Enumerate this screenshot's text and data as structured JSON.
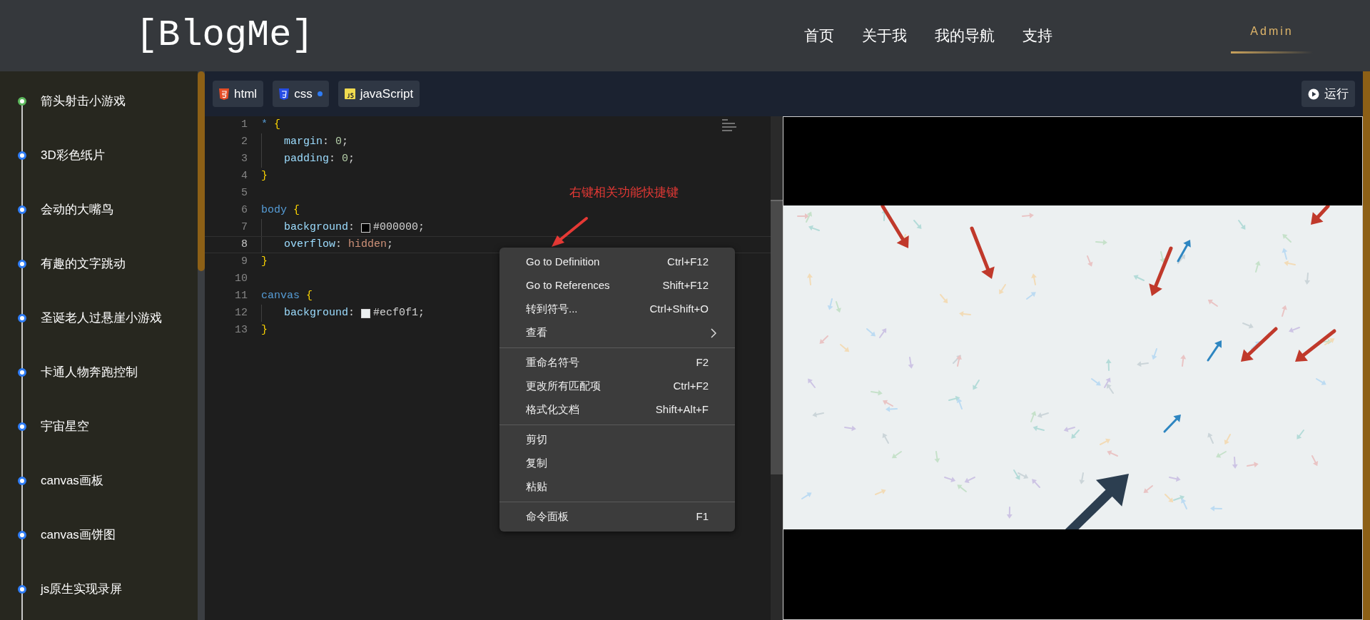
{
  "header": {
    "logo": "[BlogMe]",
    "nav": [
      "首页",
      "关于我",
      "我的导航",
      "支持"
    ],
    "user": "Admin"
  },
  "sidebar": {
    "items": [
      {
        "label": "箭头射击小游戏",
        "selected": true
      },
      {
        "label": "3D彩色纸片",
        "selected": false
      },
      {
        "label": "会动的大嘴鸟",
        "selected": false
      },
      {
        "label": "有趣的文字跳动",
        "selected": false
      },
      {
        "label": "圣诞老人过悬崖小游戏",
        "selected": false
      },
      {
        "label": "卡通人物奔跑控制",
        "selected": false
      },
      {
        "label": "宇宙星空",
        "selected": false
      },
      {
        "label": "canvas画板",
        "selected": false
      },
      {
        "label": "canvas画饼图",
        "selected": false
      },
      {
        "label": "js原生实现录屏",
        "selected": false
      }
    ]
  },
  "editor_tabs": [
    {
      "kind": "html",
      "label": "html",
      "modified": false
    },
    {
      "kind": "css",
      "label": "css",
      "modified": true
    },
    {
      "kind": "js",
      "label": "javaScript",
      "modified": false
    }
  ],
  "run_button": "运行",
  "code_lines": [
    {
      "number": "1",
      "current": false,
      "indent": false,
      "tokens": [
        {
          "kind": "selector",
          "text": "* "
        },
        {
          "kind": "brace",
          "text": "{"
        }
      ]
    },
    {
      "number": "2",
      "current": false,
      "indent": true,
      "tokens": [
        {
          "kind": "property",
          "text": "margin"
        },
        {
          "kind": "punct",
          "text": ": "
        },
        {
          "kind": "number",
          "text": "0"
        },
        {
          "kind": "punct",
          "text": ";"
        }
      ]
    },
    {
      "number": "3",
      "current": false,
      "indent": true,
      "tokens": [
        {
          "kind": "property",
          "text": "padding"
        },
        {
          "kind": "punct",
          "text": ": "
        },
        {
          "kind": "number",
          "text": "0"
        },
        {
          "kind": "punct",
          "text": ";"
        }
      ]
    },
    {
      "number": "4",
      "current": false,
      "indent": false,
      "tokens": [
        {
          "kind": "brace",
          "text": "}"
        }
      ]
    },
    {
      "number": "5",
      "current": false,
      "indent": false
    },
    {
      "number": "6",
      "current": false,
      "indent": false,
      "tokens": [
        {
          "kind": "selector",
          "text": "body "
        },
        {
          "kind": "brace",
          "text": "{"
        }
      ]
    },
    {
      "number": "7",
      "current": false,
      "indent": true,
      "tokens": [
        {
          "kind": "property",
          "text": "background"
        },
        {
          "kind": "punct",
          "text": ": "
        },
        {
          "kind": "swatch",
          "color": "#000000"
        },
        {
          "kind": "punct",
          "text": "#000000;"
        }
      ]
    },
    {
      "number": "8",
      "current": true,
      "indent": true,
      "tokens": [
        {
          "kind": "property",
          "text": "overflow"
        },
        {
          "kind": "punct",
          "text": ": "
        },
        {
          "kind": "value",
          "text": "hidden"
        },
        {
          "kind": "punct",
          "text": ";"
        }
      ]
    },
    {
      "number": "9",
      "current": false,
      "indent": false,
      "tokens": [
        {
          "kind": "brace",
          "text": "}"
        }
      ]
    },
    {
      "number": "10",
      "current": false,
      "indent": false
    },
    {
      "number": "11",
      "current": false,
      "indent": false,
      "tokens": [
        {
          "kind": "selector",
          "text": "canvas "
        },
        {
          "kind": "brace",
          "text": "{"
        }
      ]
    },
    {
      "number": "12",
      "current": false,
      "indent": true,
      "tokens": [
        {
          "kind": "property",
          "text": "background"
        },
        {
          "kind": "punct",
          "text": ": "
        },
        {
          "kind": "swatch",
          "color": "#ecf0f1"
        },
        {
          "kind": "punct",
          "text": "#ecf0f1;"
        }
      ]
    },
    {
      "number": "13",
      "current": false,
      "indent": false,
      "tokens": [
        {
          "kind": "brace",
          "text": "}"
        }
      ]
    }
  ],
  "annotation": "右键相关功能快捷键",
  "context_menu": [
    [
      {
        "kind": "command",
        "label": "Go to Definition",
        "shortcut": "Ctrl+F12"
      },
      {
        "kind": "command",
        "label": "Go to References",
        "shortcut": "Shift+F12"
      },
      {
        "kind": "command",
        "label": "转到符号...",
        "shortcut": "Ctrl+Shift+O"
      },
      {
        "kind": "submenu",
        "label": "查看"
      }
    ],
    [
      {
        "kind": "command",
        "label": "重命名符号",
        "shortcut": "F2"
      },
      {
        "kind": "command",
        "label": "更改所有匹配项",
        "shortcut": "Ctrl+F2"
      },
      {
        "kind": "command",
        "label": "格式化文档",
        "shortcut": "Shift+Alt+F"
      }
    ],
    [
      {
        "kind": "command",
        "label": "剪切"
      },
      {
        "kind": "command",
        "label": "复制"
      },
      {
        "kind": "command",
        "label": "粘贴"
      }
    ],
    [
      {
        "kind": "command",
        "label": "命令面板",
        "shortcut": "F1"
      }
    ]
  ]
}
